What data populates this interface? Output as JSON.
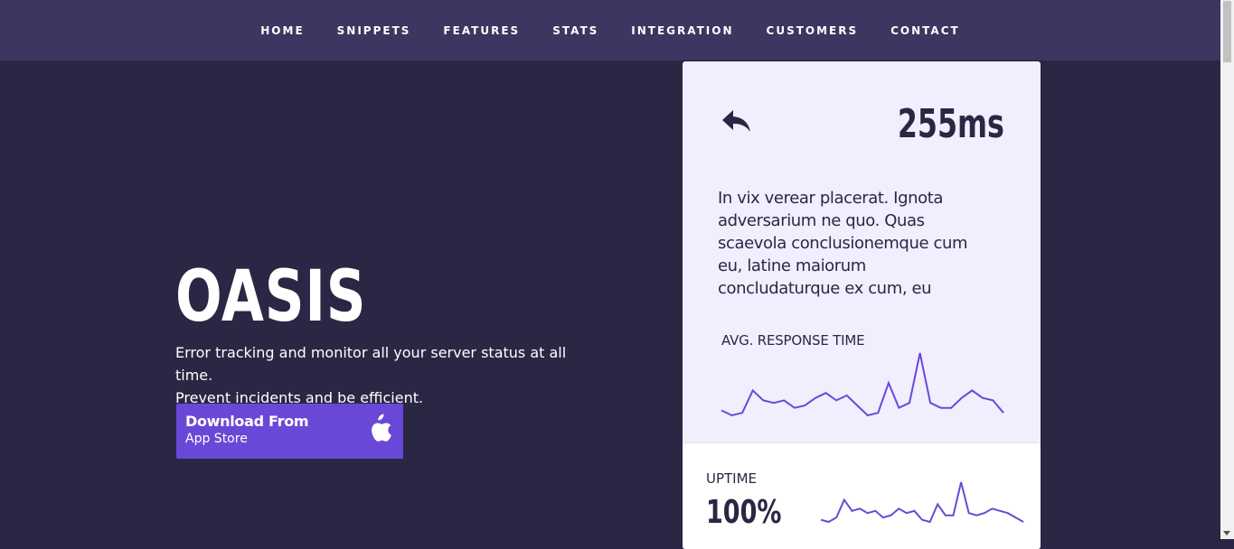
{
  "nav": {
    "items": [
      {
        "label": "HOME"
      },
      {
        "label": "SNIPPETS"
      },
      {
        "label": "FEATURES"
      },
      {
        "label": "STATS"
      },
      {
        "label": "INTEGRATION"
      },
      {
        "label": "CUSTOMERS"
      },
      {
        "label": "CONTACT"
      }
    ]
  },
  "hero": {
    "title": "OASIS",
    "description_line1": "Error tracking and monitor all your server status at all time.",
    "description_line2": "Prevent incidents and be efficient.",
    "store_button": {
      "line1": "Download From",
      "line2": "App Store",
      "icon": "apple-icon"
    }
  },
  "card": {
    "back_icon": "reply-arrow-icon",
    "latency": "255ms",
    "text": "In vix verear placerat. Ignota adversarium ne quo. Quas scaevola conclusionemque cum eu, latine maiorum concludaturque ex cum, eu",
    "response_label": "AVG. RESPONSE TIME",
    "uptime_label": "UPTIME",
    "uptime_value": "100%",
    "line_color": "#6a48d7"
  },
  "colors": {
    "background": "#2a2745",
    "nav": "#3b3760",
    "accent": "#6a48d7",
    "card": "#f1eefd"
  },
  "chart_data": [
    {
      "type": "line",
      "x": [
        0,
        1,
        2,
        3,
        4,
        5,
        6,
        7,
        8,
        9,
        10,
        11,
        12,
        13,
        14,
        15,
        16,
        17,
        18,
        19,
        20,
        21,
        22,
        23
      ],
      "values": [
        3,
        1,
        2,
        11,
        7,
        6,
        7,
        4,
        5,
        8,
        10,
        7,
        9,
        5,
        1,
        2,
        14,
        4,
        6,
        26,
        6,
        4,
        4,
        8,
        11,
        8,
        7,
        2
      ]
    },
    {
      "type": "line",
      "values": [
        3,
        2,
        4,
        12,
        7,
        8,
        6,
        7,
        4,
        5,
        8,
        6,
        7,
        3,
        2,
        10,
        5,
        5,
        20,
        6,
        5,
        6,
        8,
        7,
        6,
        4,
        2
      ]
    }
  ]
}
